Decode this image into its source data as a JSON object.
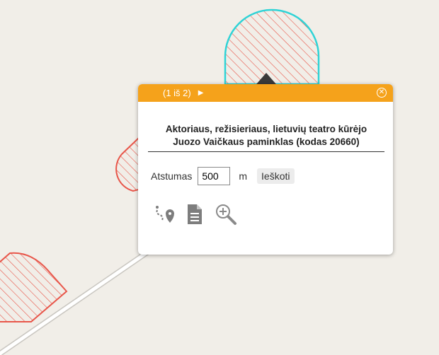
{
  "popup": {
    "pager": "(1 iš 2)",
    "next_glyph": "▶",
    "close_glyph": "✕",
    "title_line1": "Aktoriaus, režisieriaus, lietuvių teatro kūrėjo",
    "title_line2": "Juozo Vaičkaus paminklas (kodas 20660)",
    "distance_label": "Atstumas",
    "distance_value": "500",
    "distance_unit": "m",
    "search_label": "Ieškoti",
    "tools": [
      {
        "icon": "route-icon"
      },
      {
        "icon": "document-icon"
      },
      {
        "icon": "zoom-in-icon"
      }
    ]
  },
  "colors": {
    "map_background": "#f1eee8",
    "header": "#f5a21b",
    "selected_feature": "#2fd3d6",
    "feature": "#e8564a",
    "road": "#ffffff"
  }
}
